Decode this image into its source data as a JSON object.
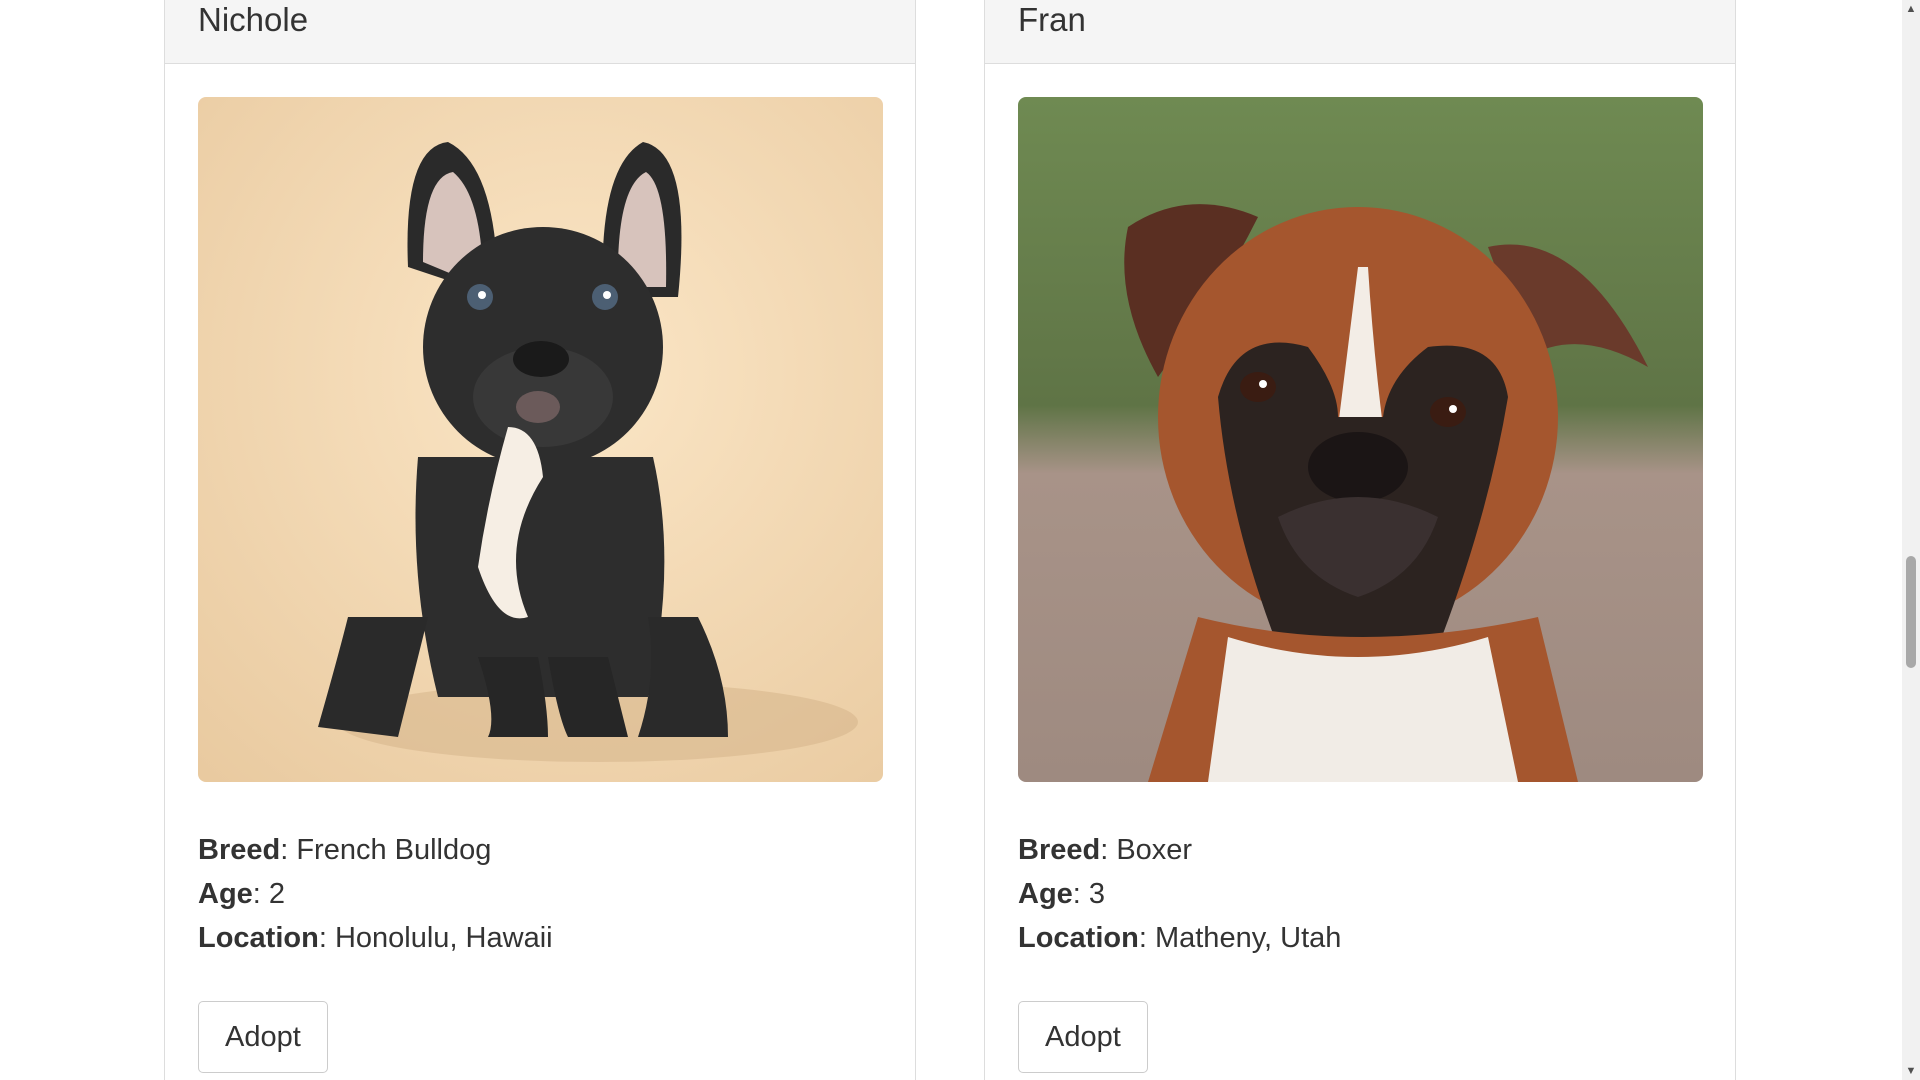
{
  "dogs": [
    {
      "name": "Nichole",
      "photo_icon": "french-bulldog-photo",
      "breed_label": "Breed",
      "breed": "French Bulldog",
      "age_label": "Age",
      "age": "2",
      "location_label": "Location",
      "location": "Honolulu, Hawaii",
      "button": "Adopt"
    },
    {
      "name": "Fran",
      "photo_icon": "boxer-photo",
      "breed_label": "Breed",
      "breed": "Boxer",
      "age_label": "Age",
      "age": "3",
      "location_label": "Location",
      "location": "Matheny, Utah",
      "button": "Adopt"
    }
  ],
  "colors": {
    "panel_heading_bg": "#f5f5f5",
    "border": "#dddddd",
    "text": "#333333"
  }
}
